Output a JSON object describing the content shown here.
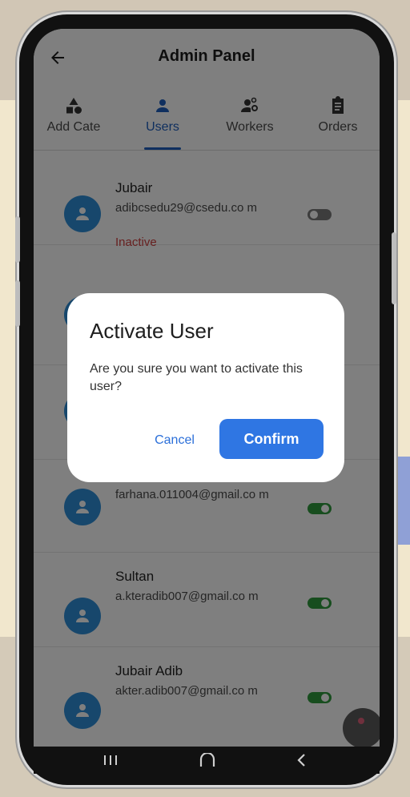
{
  "app": {
    "title": "Admin Panel"
  },
  "tabs": [
    {
      "label": "Add Cate",
      "icon": "category-icon",
      "active": false
    },
    {
      "label": "Users",
      "icon": "person-icon",
      "active": true
    },
    {
      "label": "Workers",
      "icon": "manage-accounts-icon",
      "active": false
    },
    {
      "label": "Orders",
      "icon": "clipboard-icon",
      "active": false
    }
  ],
  "users": [
    {
      "name": "Jubair",
      "email": "adibcsedu29@csedu.co m",
      "status": "Inactive",
      "active": false
    },
    {
      "name": "",
      "email": "",
      "status": "",
      "active": false
    },
    {
      "name": "",
      "email": "",
      "status": "",
      "active": false
    },
    {
      "name": "",
      "email": "farhana.011004@gmail.co m",
      "status": "",
      "active": true
    },
    {
      "name": "Sultan",
      "email": "a.kteradib007@gmail.co m",
      "status": "",
      "active": true
    },
    {
      "name": "Jubair Adib",
      "email": "akter.adib007@gmail.co m",
      "status": "",
      "active": true
    }
  ],
  "dialog": {
    "title": "Activate User",
    "message": "Are you sure you want to activate this user?",
    "cancel_label": "Cancel",
    "confirm_label": "Confirm"
  },
  "colors": {
    "accent": "#2f76e3",
    "avatar": "#2f8fd8",
    "toggle_on": "#2e9a3c",
    "inactive_text": "#d04040"
  }
}
